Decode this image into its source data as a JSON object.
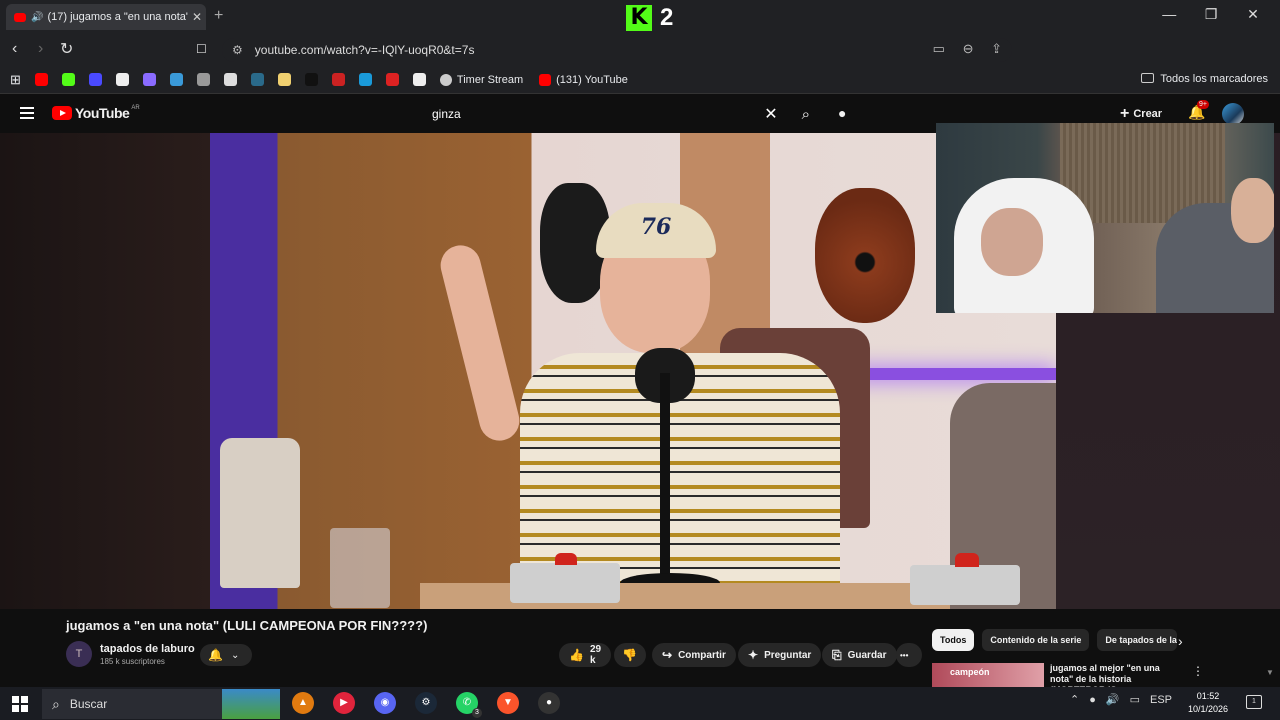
{
  "browser": {
    "tab": {
      "title": "(17) jugamos a \"en una nota\"",
      "close": "✕",
      "audio_icon": "speaker-icon"
    },
    "new_tab": "+",
    "kick_overlay": {
      "letter": "K",
      "number": "2"
    },
    "window_controls": {
      "minimize": "—",
      "maximize": "❐",
      "close": "✕"
    },
    "nav": {
      "back": "‹",
      "forward": "›",
      "reload": "↻",
      "bookmark": "🔖"
    },
    "url": "youtube.com/watch?v=-IQlY-uoqR0&t=7s",
    "url_actions": [
      "▭",
      "⊖",
      "⇪"
    ],
    "bookmarks": [
      {
        "color": "#ff0000"
      },
      {
        "color": "#53fc18"
      },
      {
        "color": "#4a4aff"
      },
      {
        "color": "#eeeeee"
      },
      {
        "color": "#8a6bff"
      },
      {
        "color": "#3a9ad9"
      },
      {
        "color": "#999999"
      },
      {
        "color": "#dddddd"
      },
      {
        "color": "#2a6a8a"
      },
      {
        "color": "#f0d070"
      },
      {
        "color": "#111111"
      },
      {
        "color": "#cc2222"
      },
      {
        "color": "#1a9ad9"
      },
      {
        "color": "#dd2222"
      },
      {
        "color": "#eeeeee"
      }
    ],
    "bookmark_labeled": [
      {
        "label": "Timer Stream",
        "color": "#cccccc"
      },
      {
        "label": "(131) YouTube",
        "color": "#ff0000"
      }
    ],
    "all_bookmarks": "Todos los marcadores"
  },
  "youtube": {
    "logo": "YouTube",
    "logo_country": "AR",
    "search_query": "ginza",
    "clear": "✕",
    "search_icon": "⌕",
    "mic": "🎤",
    "create": "Crear",
    "notifications_badge": "9+",
    "video_title": "jugamos a \"en una nota\" (LULI CAMPEONA POR FIN????)",
    "cap_text": "76",
    "channel": {
      "name": "tapados de laburo",
      "subs": "185 k suscriptores"
    },
    "likes": "29 k",
    "share": "Compartir",
    "ask": "Preguntar",
    "save": "Guardar",
    "more": "•••",
    "chips": [
      "Todos",
      "Contenido de la serie",
      "De tapados de laburo"
    ],
    "rec": {
      "thumb_text": "campeón",
      "title": "jugamos al mejor \"en una nota\" de la historia (MORTEROR IS"
    }
  },
  "taskbar": {
    "search": "Buscar",
    "apps": [
      {
        "name": "vlc-icon",
        "color": "#e07a10",
        "glyph": "▲"
      },
      {
        "name": "media-player-icon",
        "color": "#e0243c",
        "glyph": "▶"
      },
      {
        "name": "discord-icon",
        "color": "#5865f2",
        "glyph": "◉"
      },
      {
        "name": "steam-icon",
        "color": "#1b2838",
        "glyph": "⚙"
      },
      {
        "name": "whatsapp-icon",
        "color": "#25d366",
        "glyph": "✆",
        "badge": "3"
      },
      {
        "name": "brave-icon",
        "color": "#fb542b",
        "glyph": "▼"
      },
      {
        "name": "obs-icon",
        "color": "#333333",
        "glyph": "●"
      }
    ],
    "tray_lang": "ESP",
    "time": "01:52",
    "date": "10/1/2026",
    "notif_count": "1"
  }
}
